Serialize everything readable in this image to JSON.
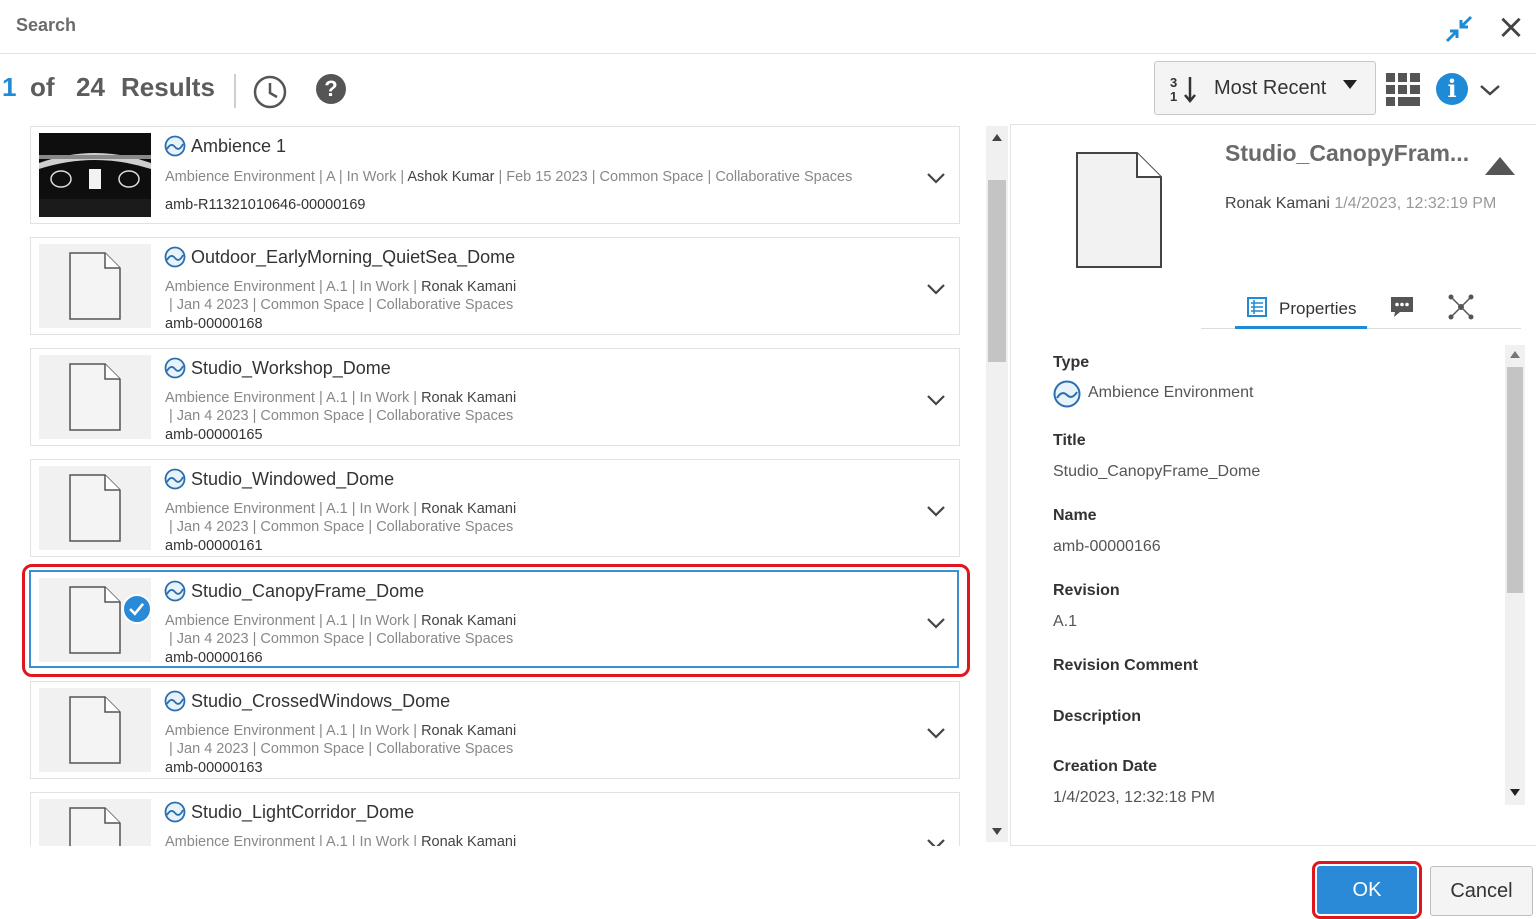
{
  "dialog": {
    "title": "Search",
    "icons": {
      "collapse": "collapse-arrows-icon",
      "close": "close-icon"
    }
  },
  "results": {
    "current": "1",
    "of_label": "of",
    "total": "24",
    "label": "Results"
  },
  "toolbar": {
    "sort_label": "Most Recent",
    "help_glyph": "?",
    "info_glyph": "i",
    "icons": [
      "history-icon",
      "help-icon",
      "sort-icon",
      "grid-view-icon",
      "info-icon",
      "chevron-down-icon"
    ]
  },
  "items": [
    {
      "name": "Ambience 1",
      "type": "Ambience Environment",
      "revision": "A",
      "state": "In Work",
      "owner": "Ashok Kumar",
      "date": "Feb 15 2023",
      "project": "Common Space",
      "collab": "Collaborative Spaces",
      "id": "amb-R11321010646-00000169",
      "thumbnail": "dark-image",
      "selected": false
    },
    {
      "name": "Outdoor_EarlyMorning_QuietSea_Dome",
      "type": "Ambience Environment",
      "revision": "A.1",
      "state": "In Work",
      "owner": "Ronak Kamani",
      "date": "Jan 4 2023",
      "project": "Common Space",
      "collab": "Collaborative Spaces",
      "id": "amb-00000168",
      "selected": false
    },
    {
      "name": "Studio_Workshop_Dome",
      "type": "Ambience Environment",
      "revision": "A.1",
      "state": "In Work",
      "owner": "Ronak Kamani",
      "date": "Jan 4 2023",
      "project": "Common Space",
      "collab": "Collaborative Spaces",
      "id": "amb-00000165",
      "selected": false
    },
    {
      "name": "Studio_Windowed_Dome",
      "type": "Ambience Environment",
      "revision": "A.1",
      "state": "In Work",
      "owner": "Ronak Kamani",
      "date": "Jan 4 2023",
      "project": "Common Space",
      "collab": "Collaborative Spaces",
      "id": "amb-00000161",
      "selected": false
    },
    {
      "name": "Studio_CanopyFrame_Dome",
      "type": "Ambience Environment",
      "revision": "A.1",
      "state": "In Work",
      "owner": "Ronak Kamani",
      "date": "Jan 4 2023",
      "project": "Common Space",
      "collab": "Collaborative Spaces",
      "id": "amb-00000166",
      "selected": true
    },
    {
      "name": "Studio_CrossedWindows_Dome",
      "type": "Ambience Environment",
      "revision": "A.1",
      "state": "In Work",
      "owner": "Ronak Kamani",
      "date": "Jan 4 2023",
      "project": "Common Space",
      "collab": "Collaborative Spaces",
      "id": "amb-00000163",
      "selected": false
    },
    {
      "name": "Studio_LightCorridor_Dome",
      "type": "Ambience Environment",
      "revision": "A.1",
      "state": "In Work",
      "owner": "Ronak Kamani",
      "selected": false
    }
  ],
  "details": {
    "title": "Studio_CanopyFram...",
    "owner": "Ronak Kamani",
    "modified": "1/4/2023, 12:32:19 PM",
    "tabs": {
      "properties": "Properties",
      "icons": [
        "properties-icon",
        "comments-icon",
        "relations-icon"
      ]
    },
    "properties": [
      {
        "label": "Type",
        "value": "Ambience Environment"
      },
      {
        "label": "Title",
        "value": "Studio_CanopyFrame_Dome"
      },
      {
        "label": "Name",
        "value": "amb-00000166"
      },
      {
        "label": "Revision",
        "value": "A.1"
      },
      {
        "label": "Revision Comment",
        "value": ""
      },
      {
        "label": "Description",
        "value": ""
      },
      {
        "label": "Creation Date",
        "value": "1/4/2023, 12:32:18 PM"
      }
    ]
  },
  "footer": {
    "ok_label": "OK",
    "cancel_label": "Cancel"
  },
  "colors": {
    "accent": "#1f8ad6",
    "highlight": "#e0161e",
    "ok_button": "#2a8ad8"
  }
}
